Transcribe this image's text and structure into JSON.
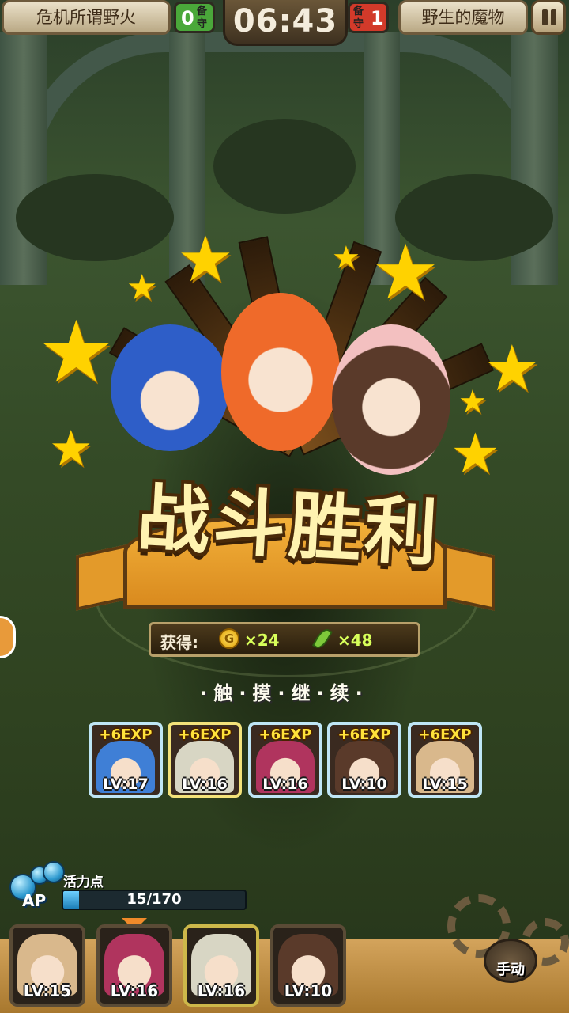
{
  "hud": {
    "left_stage": "危机所谓野火",
    "left_score": "0",
    "left_score_label": "备守",
    "timer": "06:43",
    "right_score": "1",
    "right_score_label": "备守",
    "right_stage": "野生的魔物"
  },
  "result": {
    "title": "战斗胜利",
    "reward_label": "获得:",
    "coin_symbol": "G",
    "coin_amount": "×24",
    "leaf_amount": "×48",
    "touch_continue": "·触·摸·继·续·"
  },
  "exp_cards": [
    {
      "exp": "+6EXP",
      "level": "LV:17",
      "color": "#3f7fd6"
    },
    {
      "exp": "+6EXP",
      "level": "LV:16",
      "color": "#d8d6c4"
    },
    {
      "exp": "+6EXP",
      "level": "LV:16",
      "color": "#b0345e"
    },
    {
      "exp": "+6EXP",
      "level": "LV:10",
      "color": "#5a3a2a"
    },
    {
      "exp": "+6EXP",
      "level": "LV:15",
      "color": "#d9b88c"
    }
  ],
  "ap": {
    "label": "活力点",
    "tag": "AP",
    "text": "15/170",
    "fill_fraction": 0.088
  },
  "party": [
    {
      "level": "LV:15",
      "color": "#d9b88c"
    },
    {
      "level": "LV:16",
      "color": "#b0345e"
    },
    {
      "level": "LV:16",
      "color": "#d8d6c4"
    },
    {
      "level": "LV:10",
      "color": "#5a3a2a"
    }
  ],
  "manual_button": "手动",
  "colors": {
    "accent_orange": "#e39a2a",
    "exp_yellow": "#ffe23a",
    "reward_green": "#d8ff5a",
    "ap_blue": "#2e9ad0"
  },
  "icons": [
    "pause-icon",
    "coin-icon",
    "leaf-icon",
    "gear-icon",
    "star-icon",
    "orb-icon",
    "arrow-icon"
  ]
}
